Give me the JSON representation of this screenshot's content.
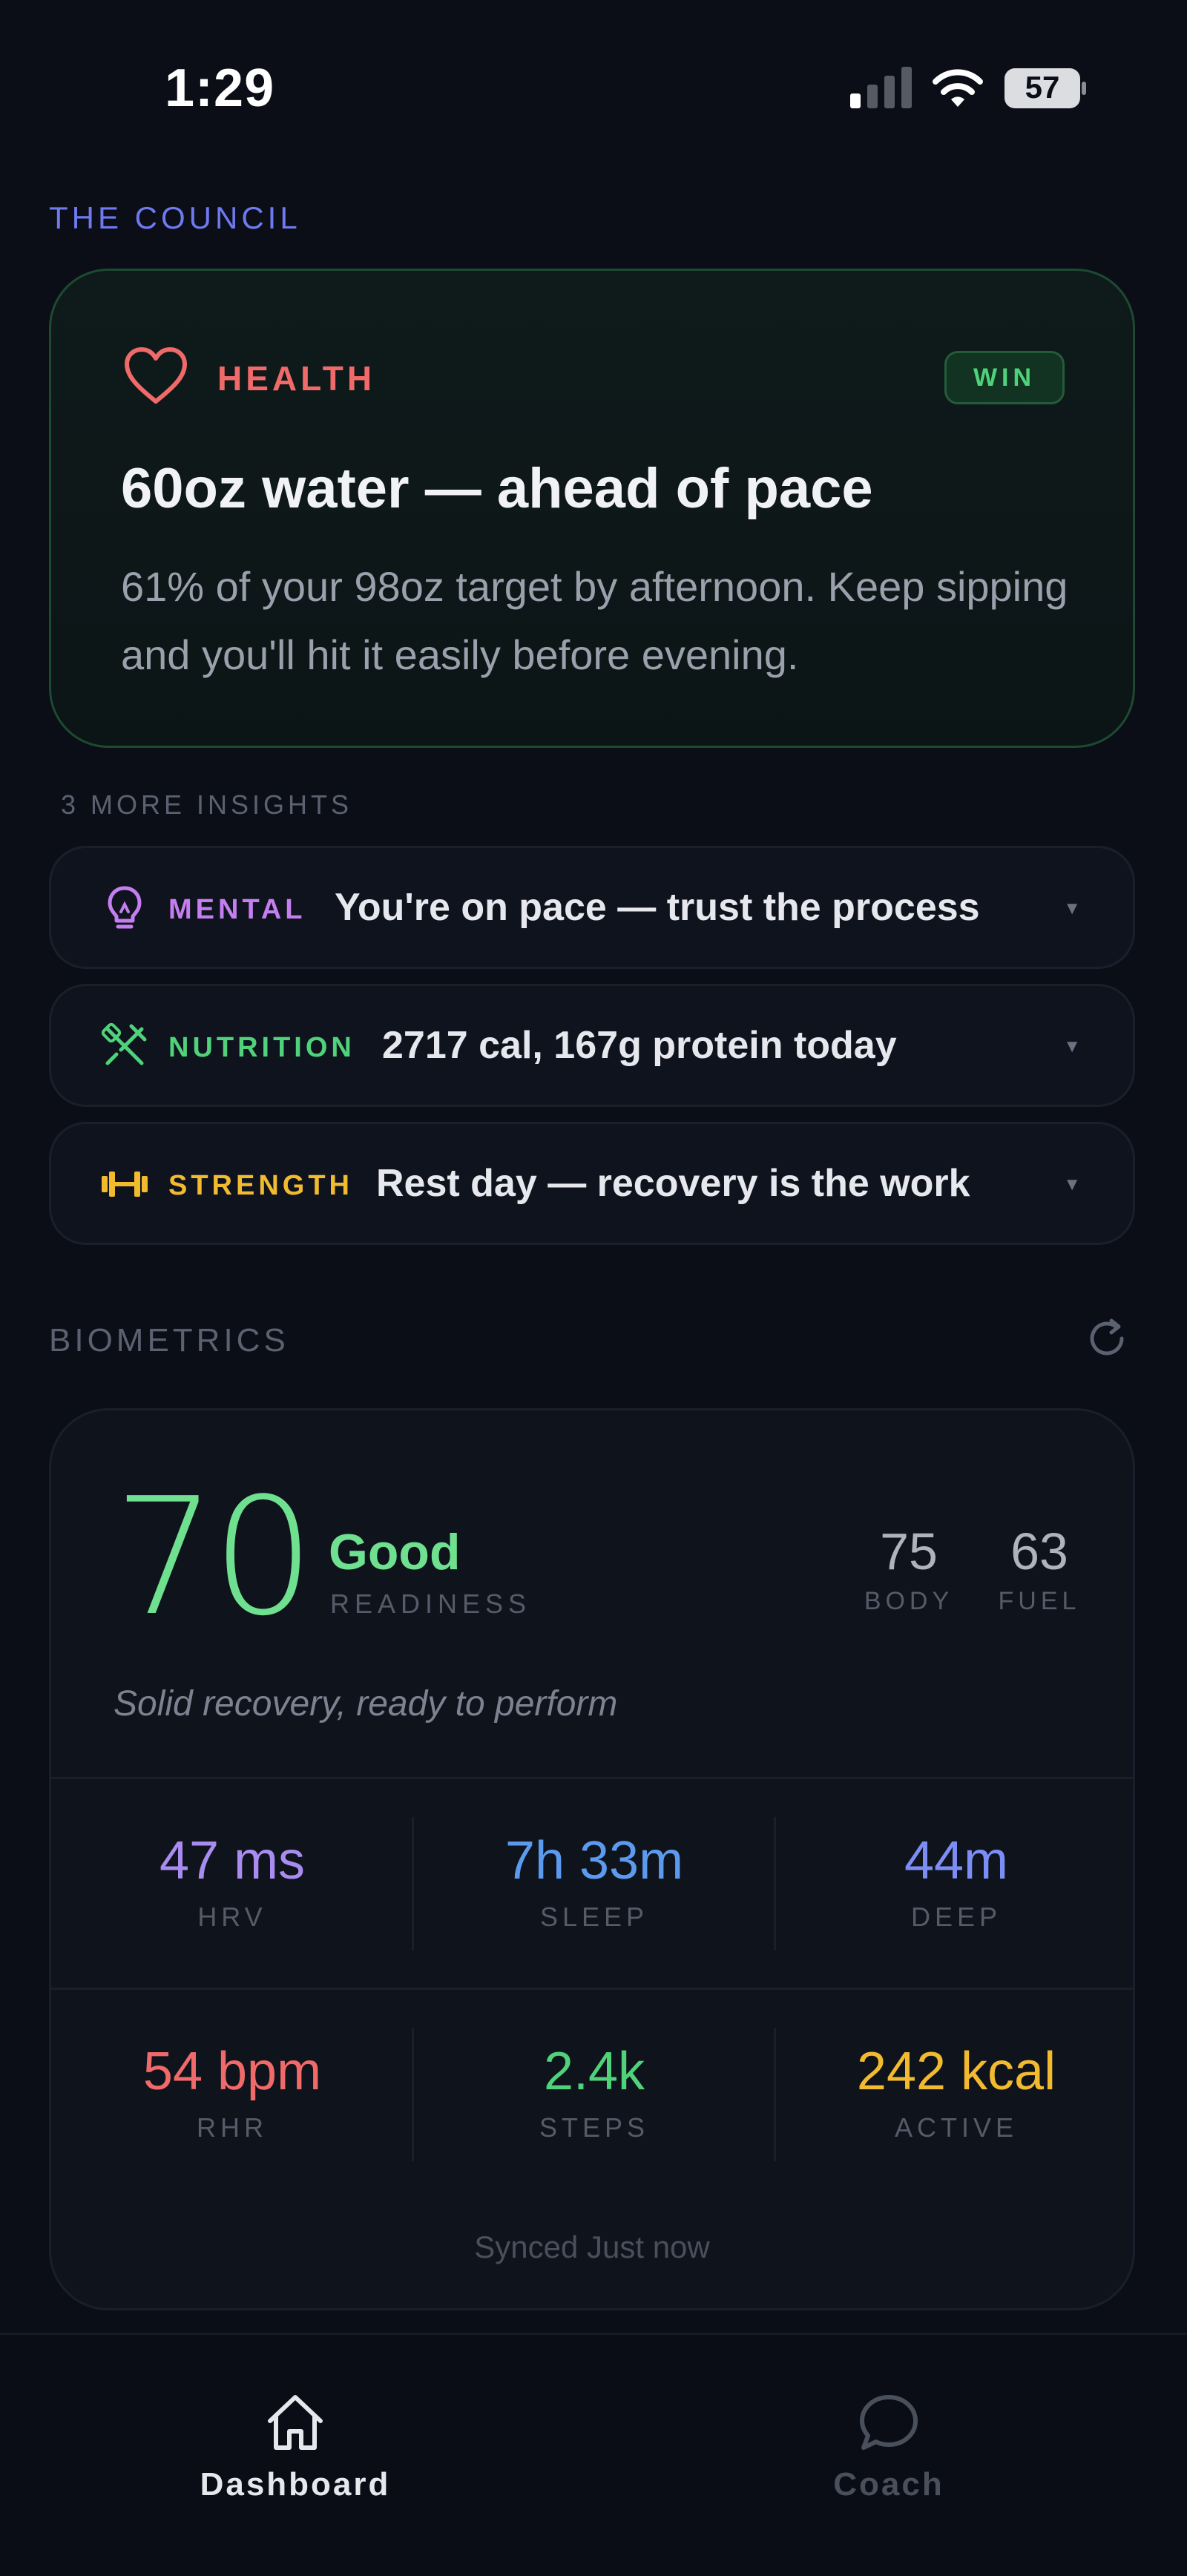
{
  "status": {
    "time": "1:29",
    "battery": "57"
  },
  "council": {
    "label": "THE COUNCIL",
    "hero": {
      "category": "HEALTH",
      "badge": "WIN",
      "title": "60oz water — ahead of pace",
      "body": "61% of your 98oz target by afternoon. Keep sipping and you'll hit it easily before evening.",
      "icon": "heart-icon",
      "color": "#f06a6a"
    },
    "more_label": "3 MORE INSIGHTS",
    "insights": [
      {
        "category": "MENTAL",
        "message": "You're on pace — trust the process",
        "icon": "lightbulb-icon",
        "color": "#c47ef0"
      },
      {
        "category": "NUTRITION",
        "message": "2717 cal, 167g protein today",
        "icon": "utensils-icon",
        "color": "#4fd27a"
      },
      {
        "category": "STRENGTH",
        "message": "Rest day — recovery is the work",
        "icon": "dumbbell-icon",
        "color": "#f2bb2f"
      }
    ]
  },
  "biometrics": {
    "label": "BIOMETRICS",
    "readiness": {
      "score": "70",
      "status": "Good",
      "label": "READINESS",
      "note": "Solid recovery, ready to perform"
    },
    "body": {
      "value": "75",
      "label": "BODY"
    },
    "fuel": {
      "value": "63",
      "label": "FUEL"
    },
    "metrics": [
      {
        "value": "47 ms",
        "label": "HRV",
        "color": "#a98cf0"
      },
      {
        "value": "7h 33m",
        "label": "SLEEP",
        "color": "#5c9af0"
      },
      {
        "value": "44m",
        "label": "DEEP",
        "color": "#7c8ef5"
      },
      {
        "value": "54 bpm",
        "label": "RHR",
        "color": "#f06a6a"
      },
      {
        "value": "2.4k",
        "label": "STEPS",
        "color": "#4fd27a"
      },
      {
        "value": "242 kcal",
        "label": "ACTIVE",
        "color": "#f2bb2f"
      }
    ],
    "synced": "Synced Just now"
  },
  "tabs": [
    {
      "label": "Dashboard",
      "icon": "home-icon",
      "active": true
    },
    {
      "label": "Coach",
      "icon": "chat-bubble-icon",
      "active": false
    }
  ]
}
